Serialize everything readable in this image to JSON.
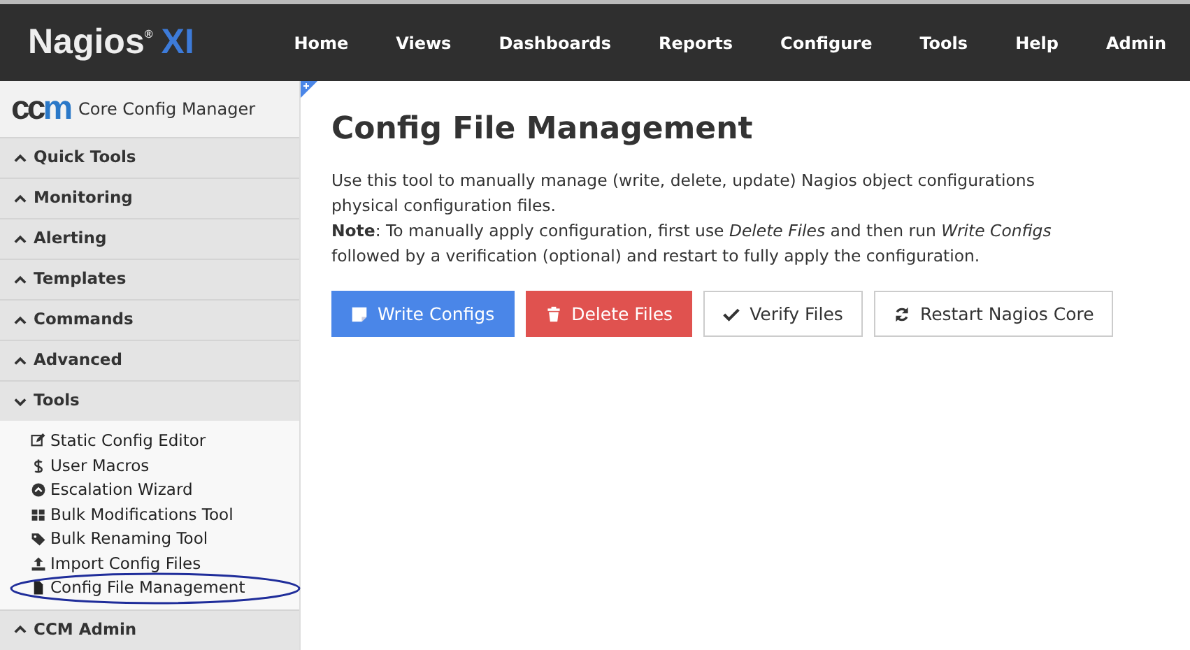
{
  "logo": {
    "name": "Nagios",
    "mark": "®",
    "suffix": "XI"
  },
  "nav": [
    {
      "label": "Home"
    },
    {
      "label": "Views"
    },
    {
      "label": "Dashboards"
    },
    {
      "label": "Reports"
    },
    {
      "label": "Configure"
    },
    {
      "label": "Tools"
    },
    {
      "label": "Help"
    },
    {
      "label": "Admin"
    }
  ],
  "sidebar": {
    "logo": {
      "dark": "cc",
      "accent": "m"
    },
    "title": "Core Config Manager",
    "sections": [
      {
        "label": "Quick Tools",
        "expanded": false
      },
      {
        "label": "Monitoring",
        "expanded": false
      },
      {
        "label": "Alerting",
        "expanded": false
      },
      {
        "label": "Templates",
        "expanded": false
      },
      {
        "label": "Commands",
        "expanded": false
      },
      {
        "label": "Advanced",
        "expanded": false
      },
      {
        "label": "Tools",
        "expanded": true,
        "items": [
          {
            "label": "Static Config Editor",
            "selected": false
          },
          {
            "label": "User Macros",
            "selected": false
          },
          {
            "label": "Escalation Wizard",
            "selected": false
          },
          {
            "label": "Bulk Modifications Tool",
            "selected": false
          },
          {
            "label": "Bulk Renaming Tool",
            "selected": false
          },
          {
            "label": "Import Config Files",
            "selected": false
          },
          {
            "label": "Config File Management",
            "selected": true
          }
        ]
      },
      {
        "label": "CCM Admin",
        "expanded": false
      }
    ]
  },
  "page": {
    "title": "Config File Management",
    "intro": "Use this tool to manually manage (write, delete, update) Nagios object configurations physical configuration files.",
    "note": "**Note**: To manually apply configuration, first use *Delete Files* and then run *Write Configs* followed by a verification (optional) and restart to fully apply the configuration.",
    "buttons": [
      {
        "label": "Write Configs",
        "kind": "primary"
      },
      {
        "label": "Delete Files",
        "kind": "danger"
      },
      {
        "label": "Verify Files",
        "kind": "default"
      },
      {
        "label": "Restart Nagios Core",
        "kind": "default"
      }
    ]
  }
}
